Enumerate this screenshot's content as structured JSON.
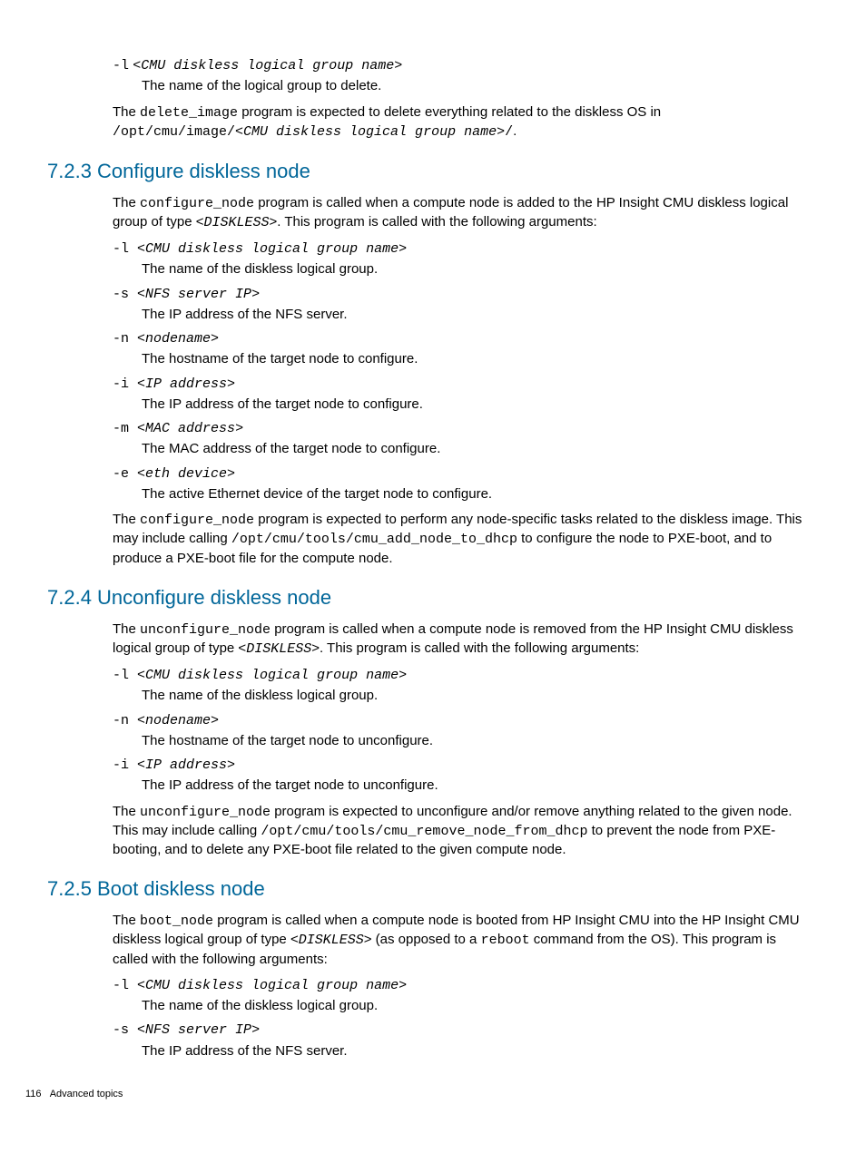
{
  "intro_arg": {
    "flag": "-l",
    "var": "CMU diskless logical group name",
    "desc": "The name of the logical group to delete."
  },
  "intro_para": {
    "p1": "The ",
    "code1": "delete_image",
    "p2": " program is expected to delete everything related to the diskless OS in ",
    "code2": "/opt/cmu/image/<",
    "var": "CMU diskless logical group name",
    "code3": ">/",
    "p3": "."
  },
  "s723": {
    "title": "7.2.3 Configure diskless node",
    "intro_a": "The ",
    "intro_code": "configure_node",
    "intro_b": " program is called when a compute node is added to the HP Insight CMU diskless logical group of type <",
    "intro_var": "DISKLESS",
    "intro_c": ">. This program is called with the following arguments:",
    "args": [
      {
        "flag": "-l",
        "var": "CMU diskless logical group name",
        "desc": "The name of the diskless logical group."
      },
      {
        "flag": "-s",
        "var": "NFS server IP",
        "desc": "The IP address of the NFS server."
      },
      {
        "flag": "-n",
        "var": "nodename",
        "desc": "The hostname of the target node to configure."
      },
      {
        "flag": "-i",
        "var": "IP address",
        "desc": "The IP address of the target node to configure."
      },
      {
        "flag": "-m",
        "var": "MAC address",
        "desc": "The MAC address of the target node to configure."
      },
      {
        "flag": "-e",
        "var": "eth device",
        "desc": "The active Ethernet device of the target node to configure."
      }
    ],
    "outro_a": "The ",
    "outro_code1": "configure_node",
    "outro_b": " program is expected to perform any node-specific tasks related to the diskless image. This may include calling ",
    "outro_code2": "/opt/cmu/tools/cmu_add_node_to_dhcp",
    "outro_c": " to configure the node to PXE-boot, and to produce a PXE-boot file for the compute node."
  },
  "s724": {
    "title": "7.2.4 Unconfigure diskless node",
    "intro_a": "The ",
    "intro_code": "unconfigure_node",
    "intro_b": " program is called when a compute node is removed from the HP Insight CMU diskless logical group of type <",
    "intro_var": "DISKLESS",
    "intro_c": ">. This program is called with the following arguments:",
    "args": [
      {
        "flag": "-l",
        "var": "CMU diskless logical group name",
        "desc": "The name of the diskless logical group."
      },
      {
        "flag": "-n",
        "var": "nodename",
        "desc": "The hostname of the target node to unconfigure."
      },
      {
        "flag": "-i",
        "var": "IP address",
        "desc": "The IP address of the target node to unconfigure."
      }
    ],
    "outro_a": "The ",
    "outro_code1": "unconfigure_node",
    "outro_b": " program is expected to unconfigure and/or remove anything related to the given node. This may include calling ",
    "outro_code2": "/opt/cmu/tools/cmu_remove_node_from_dhcp",
    "outro_c": " to prevent the node from PXE-booting, and to delete any PXE-boot file related to the given compute node."
  },
  "s725": {
    "title": "7.2.5 Boot diskless node",
    "intro_a": "The ",
    "intro_code": "boot_node",
    "intro_b": " program is called when a compute node is booted from HP Insight CMU into the HP Insight CMU diskless logical group of type <",
    "intro_var": "DISKLESS",
    "intro_c": "> (as opposed to a ",
    "intro_code2": "reboot",
    "intro_d": " command from the OS). This program is called with the following arguments:",
    "args": [
      {
        "flag": "-l",
        "var": "CMU diskless logical group name",
        "desc": "The name of the diskless logical group."
      },
      {
        "flag": "-s",
        "var": "NFS server IP",
        "desc": "The IP address of the NFS server."
      }
    ]
  },
  "footer": {
    "page": "116",
    "chapter": "Advanced topics"
  }
}
